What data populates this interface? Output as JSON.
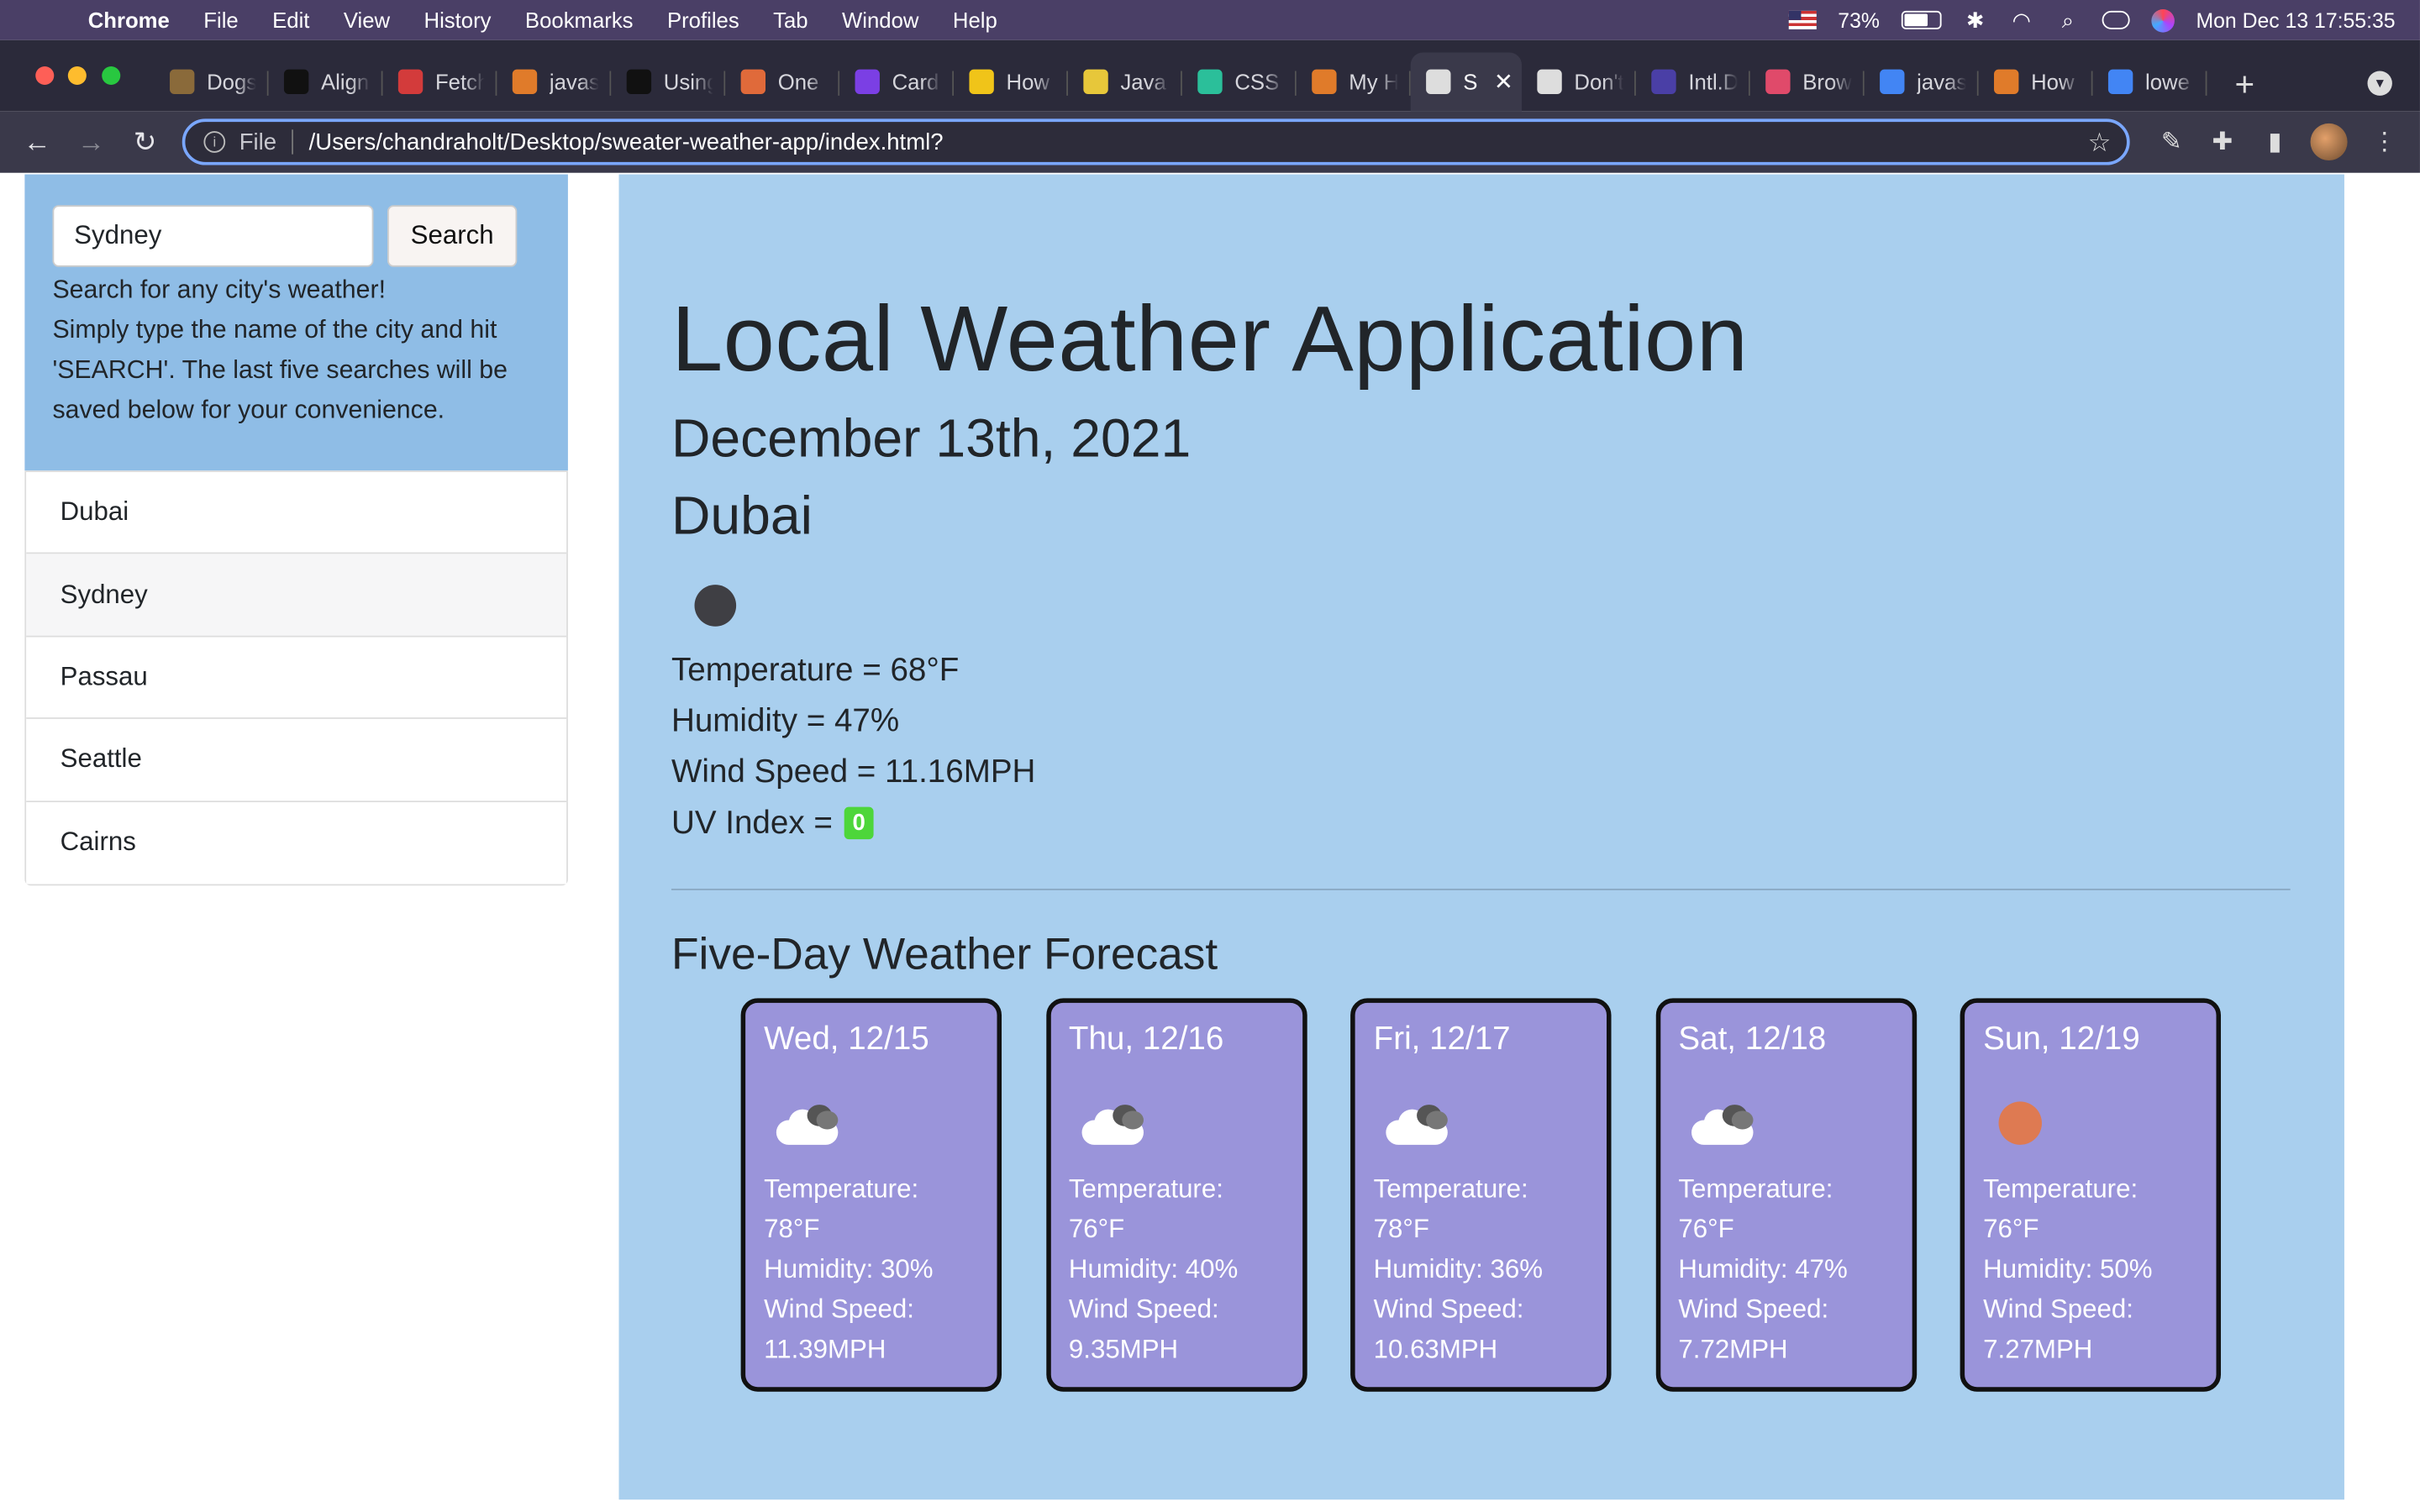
{
  "menubar": {
    "app_name": "Chrome",
    "items": [
      "File",
      "Edit",
      "View",
      "History",
      "Bookmarks",
      "Profiles",
      "Tab",
      "Window",
      "Help"
    ],
    "battery": "73%",
    "datetime": "Mon Dec 13  17:55:35"
  },
  "tabs": [
    {
      "label": "Dogs",
      "fav_color": "#8a6a3a"
    },
    {
      "label": "Align",
      "fav_color": "#111111"
    },
    {
      "label": "Fetch",
      "fav_color": "#d33b3b"
    },
    {
      "label": "javas",
      "fav_color": "#e07b2a"
    },
    {
      "label": "Using",
      "fav_color": "#111111"
    },
    {
      "label": "One",
      "fav_color": "#e06a3a"
    },
    {
      "label": "Card",
      "fav_color": "#7b3fe4"
    },
    {
      "label": "How",
      "fav_color": "#f0c419"
    },
    {
      "label": "Java",
      "fav_color": "#e7c73a"
    },
    {
      "label": "CSS",
      "fav_color": "#2bbf9a"
    },
    {
      "label": "My H",
      "fav_color": "#e07b2a"
    },
    {
      "label": "S",
      "fav_color": "#dddddd",
      "active": true
    },
    {
      "label": "Don't",
      "fav_color": "#dddddd"
    },
    {
      "label": "Intl.D",
      "fav_color": "#4a3fa6"
    },
    {
      "label": "Brow",
      "fav_color": "#e04a6a"
    },
    {
      "label": "javas",
      "fav_color": "#4285f4"
    },
    {
      "label": "How",
      "fav_color": "#e07b2a"
    },
    {
      "label": "lowe",
      "fav_color": "#4285f4"
    }
  ],
  "toolbar": {
    "scheme": "File",
    "url": "/Users/chandraholt/Desktop/sweater-weather-app/index.html?"
  },
  "sidebar": {
    "search_value": "Sydney",
    "search_button": "Search",
    "help_line1": "Search for any city's weather!",
    "help_line2": "Simply type the name of the city and hit 'SEARCH'. The last five searches will be saved below for your convenience.",
    "history": [
      "Dubai",
      "Sydney",
      "Passau",
      "Seattle",
      "Cairns"
    ]
  },
  "main": {
    "title": "Local Weather Application",
    "date": "December 13th, 2021",
    "city": "Dubai",
    "current_icon": "moon-icon",
    "temperature": "Temperature = 68°F",
    "humidity": "Humidity = 47%",
    "wind": "Wind Speed = 11.16MPH",
    "uv_label": "UV Index =",
    "uv_value": "0",
    "uv_color": "#4dd63a",
    "forecast_title": "Five-Day Weather Forecast",
    "forecast": [
      {
        "day": "Wed, 12/15",
        "icon": "cloud-icon",
        "temp_label": "Temperature:",
        "temp": "78°F",
        "humidity": "Humidity: 30%",
        "wind_label": "Wind Speed:",
        "wind": "11.39MPH"
      },
      {
        "day": "Thu, 12/16",
        "icon": "cloud-icon",
        "temp_label": "Temperature:",
        "temp": "76°F",
        "humidity": "Humidity: 40%",
        "wind_label": "Wind Speed:",
        "wind": "9.35MPH"
      },
      {
        "day": "Fri, 12/17",
        "icon": "cloud-icon",
        "temp_label": "Temperature:",
        "temp": "78°F",
        "humidity": "Humidity: 36%",
        "wind_label": "Wind Speed:",
        "wind": "10.63MPH"
      },
      {
        "day": "Sat, 12/18",
        "icon": "cloud-icon",
        "temp_label": "Temperature:",
        "temp": "76°F",
        "humidity": "Humidity: 47%",
        "wind_label": "Wind Speed:",
        "wind": "7.72MPH"
      },
      {
        "day": "Sun, 12/19",
        "icon": "sun-icon",
        "temp_label": "Temperature:",
        "temp": "76°F",
        "humidity": "Humidity: 50%",
        "wind_label": "Wind Speed:",
        "wind": "7.27MPH"
      }
    ]
  },
  "colors": {
    "sidebar_bg": "#8fbde6",
    "main_bg": "#a9cfee",
    "card_bg": "#9a94da",
    "menubar_bg": "#4a3f66"
  }
}
